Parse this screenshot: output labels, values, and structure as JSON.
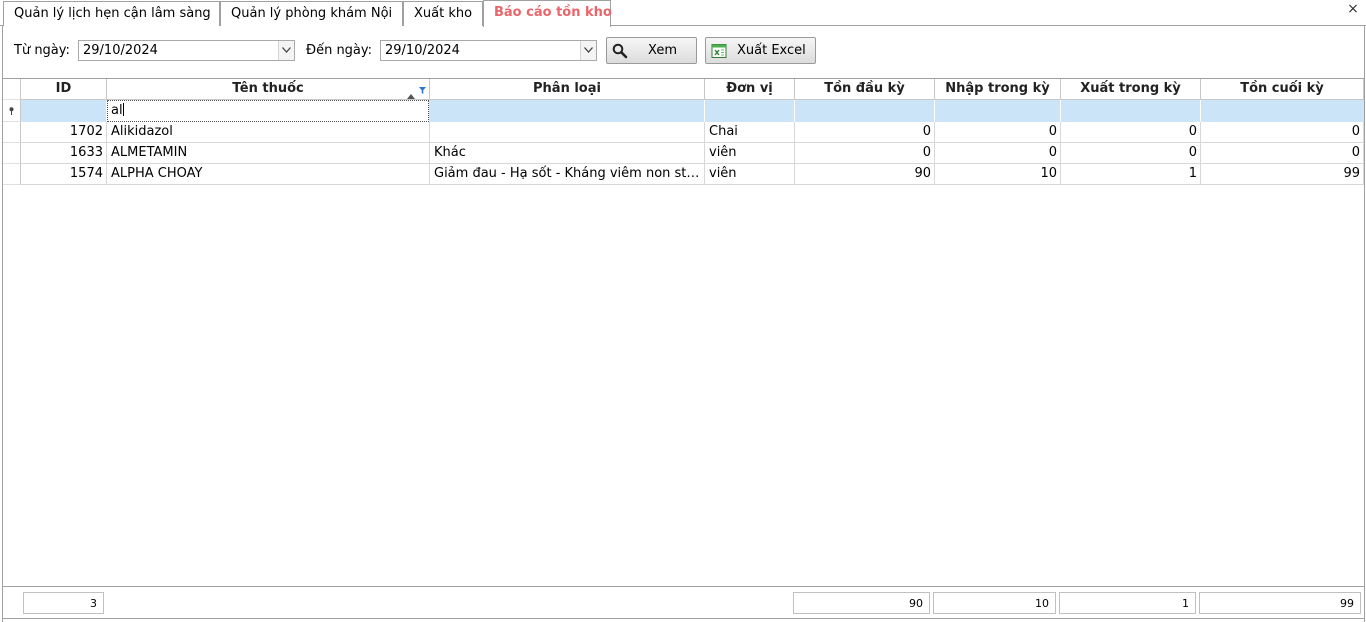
{
  "tabs": [
    {
      "label": "Quản lý lịch hẹn cận lâm sàng"
    },
    {
      "label": "Quản lý phòng khám Nội"
    },
    {
      "label": "Xuất kho"
    },
    {
      "label": "Báo cáo tồn kho"
    }
  ],
  "active_tab": "Báo cáo tồn kho",
  "close_icon": "×",
  "filter_bar": {
    "from_label": "Từ ngày:",
    "from_value": "29/10/2024",
    "to_label": "Đến ngày:",
    "to_value": "29/10/2024",
    "view_button": "Xem",
    "export_button": "Xuất Excel"
  },
  "table": {
    "columns": [
      "ID",
      "Tên thuốc",
      "Phân loại",
      "Đơn vị",
      "Tồn đầu kỳ",
      "Nhập trong kỳ",
      "Xuất trong kỳ",
      "Tồn cuối kỳ"
    ],
    "filter_text": "al",
    "rows": [
      {
        "id": "1702",
        "name": "Alikidazol",
        "category": "",
        "unit": "Chai",
        "opening": "0",
        "imported": "0",
        "exported": "0",
        "closing": "0"
      },
      {
        "id": "1633",
        "name": "ALMETAMIN",
        "category": "Khác",
        "unit": "viên",
        "opening": "0",
        "imported": "0",
        "exported": "0",
        "closing": "0"
      },
      {
        "id": "1574",
        "name": "ALPHA CHOAY",
        "category": "Giảm đau - Hạ sốt - Kháng viêm non steroid",
        "unit": "viên",
        "opening": "90",
        "imported": "10",
        "exported": "1",
        "closing": "99"
      }
    ],
    "footer": {
      "count": "3",
      "opening": "90",
      "imported": "10",
      "exported": "1",
      "closing": "99"
    }
  },
  "colors": {
    "active_tab": "#e8666b",
    "filter_row": "#cce4f7"
  }
}
